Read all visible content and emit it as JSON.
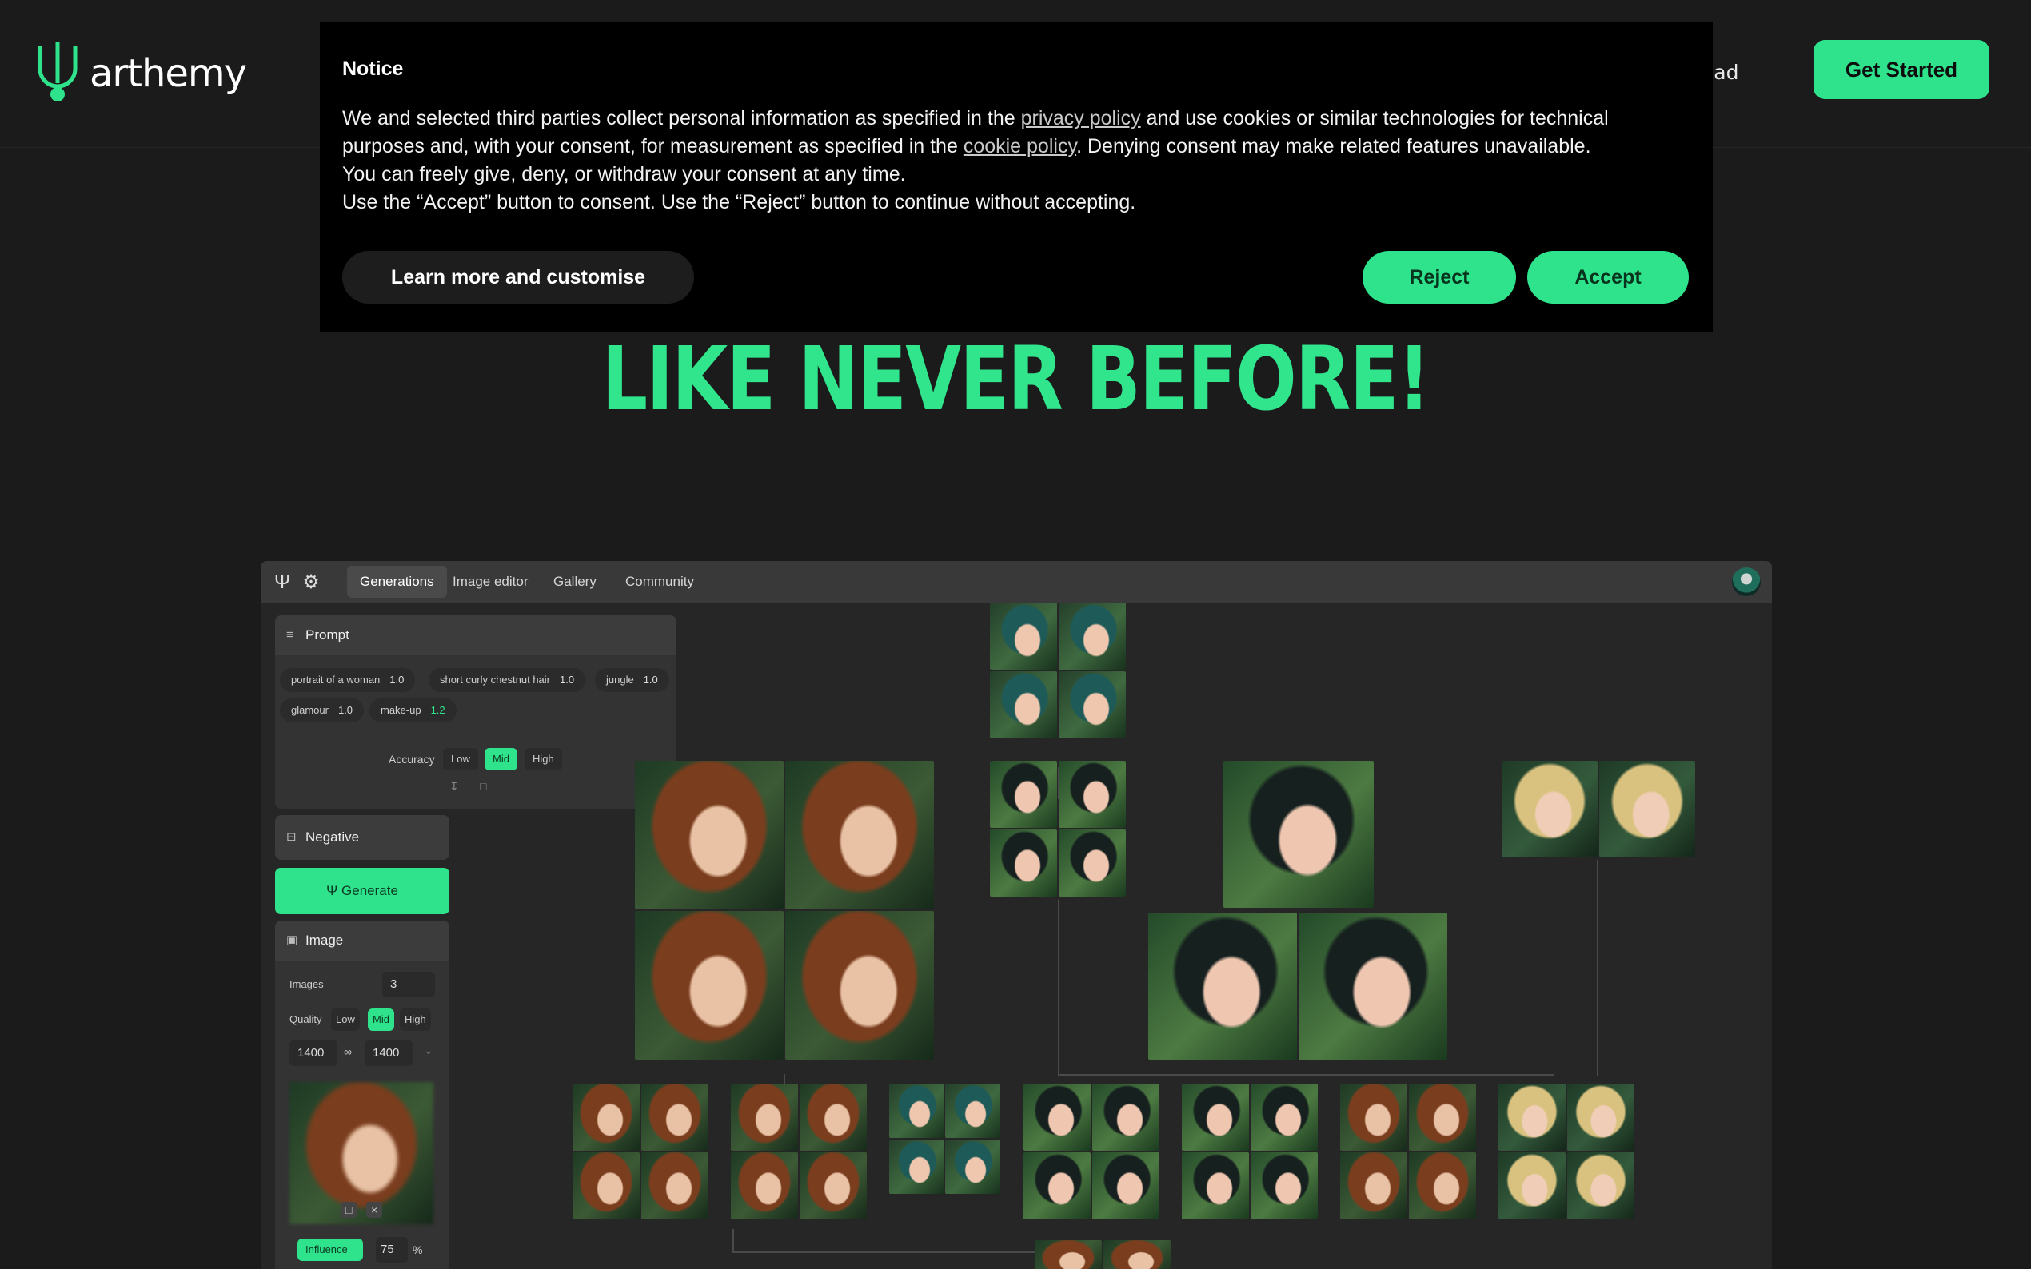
{
  "brand": {
    "name": "arthemy",
    "accent": "#2ee38b"
  },
  "nav": {
    "partial_link": "oad",
    "cta_label": "Get Started"
  },
  "hero": {
    "title": "LIKE NEVER BEFORE!"
  },
  "notice": {
    "title": "Notice",
    "line1_pre": "We and selected third parties collect personal information as specified in the ",
    "privacy_link": "privacy policy",
    "line1_mid": " and use cookies or similar technologies for technical purposes and, with your consent, for measurement as specified in the ",
    "cookie_link": "cookie policy",
    "line1_post": ". Denying consent may make related features unavailable.",
    "line2": "You can freely give, deny, or withdraw your consent at any time.",
    "line3": "Use the “Accept” button to consent. Use the “Reject” button to continue without accepting.",
    "learn_label": "Learn more and customise",
    "reject_label": "Reject",
    "accept_label": "Accept"
  },
  "app": {
    "tabs": [
      "Generations",
      "Image editor",
      "Gallery",
      "Community"
    ],
    "prompt": {
      "header": "Prompt",
      "chips": [
        {
          "text": "portrait of a woman",
          "weight": "1.0"
        },
        {
          "text": "short curly chestnut hair",
          "weight": "1.0"
        },
        {
          "text": "jungle",
          "weight": "1.0"
        },
        {
          "text": "glamour",
          "weight": "1.0"
        },
        {
          "text": "make-up",
          "weight": "1.2"
        }
      ],
      "accuracy_label": "Accuracy",
      "accuracy_options": [
        "Low",
        "Mid",
        "High"
      ],
      "accuracy_selected": "Mid"
    },
    "negative_header": "Negative",
    "generate_label": "Generate",
    "image_panel": {
      "header": "Image",
      "images_label": "Images",
      "images_value": "3",
      "quality_label": "Quality",
      "quality_options": [
        "Low",
        "Mid",
        "High"
      ],
      "quality_selected": "Mid",
      "width": "1400",
      "height": "1400",
      "influence_label": "Influence",
      "influence_value": "75",
      "influence_unit": "%"
    }
  }
}
